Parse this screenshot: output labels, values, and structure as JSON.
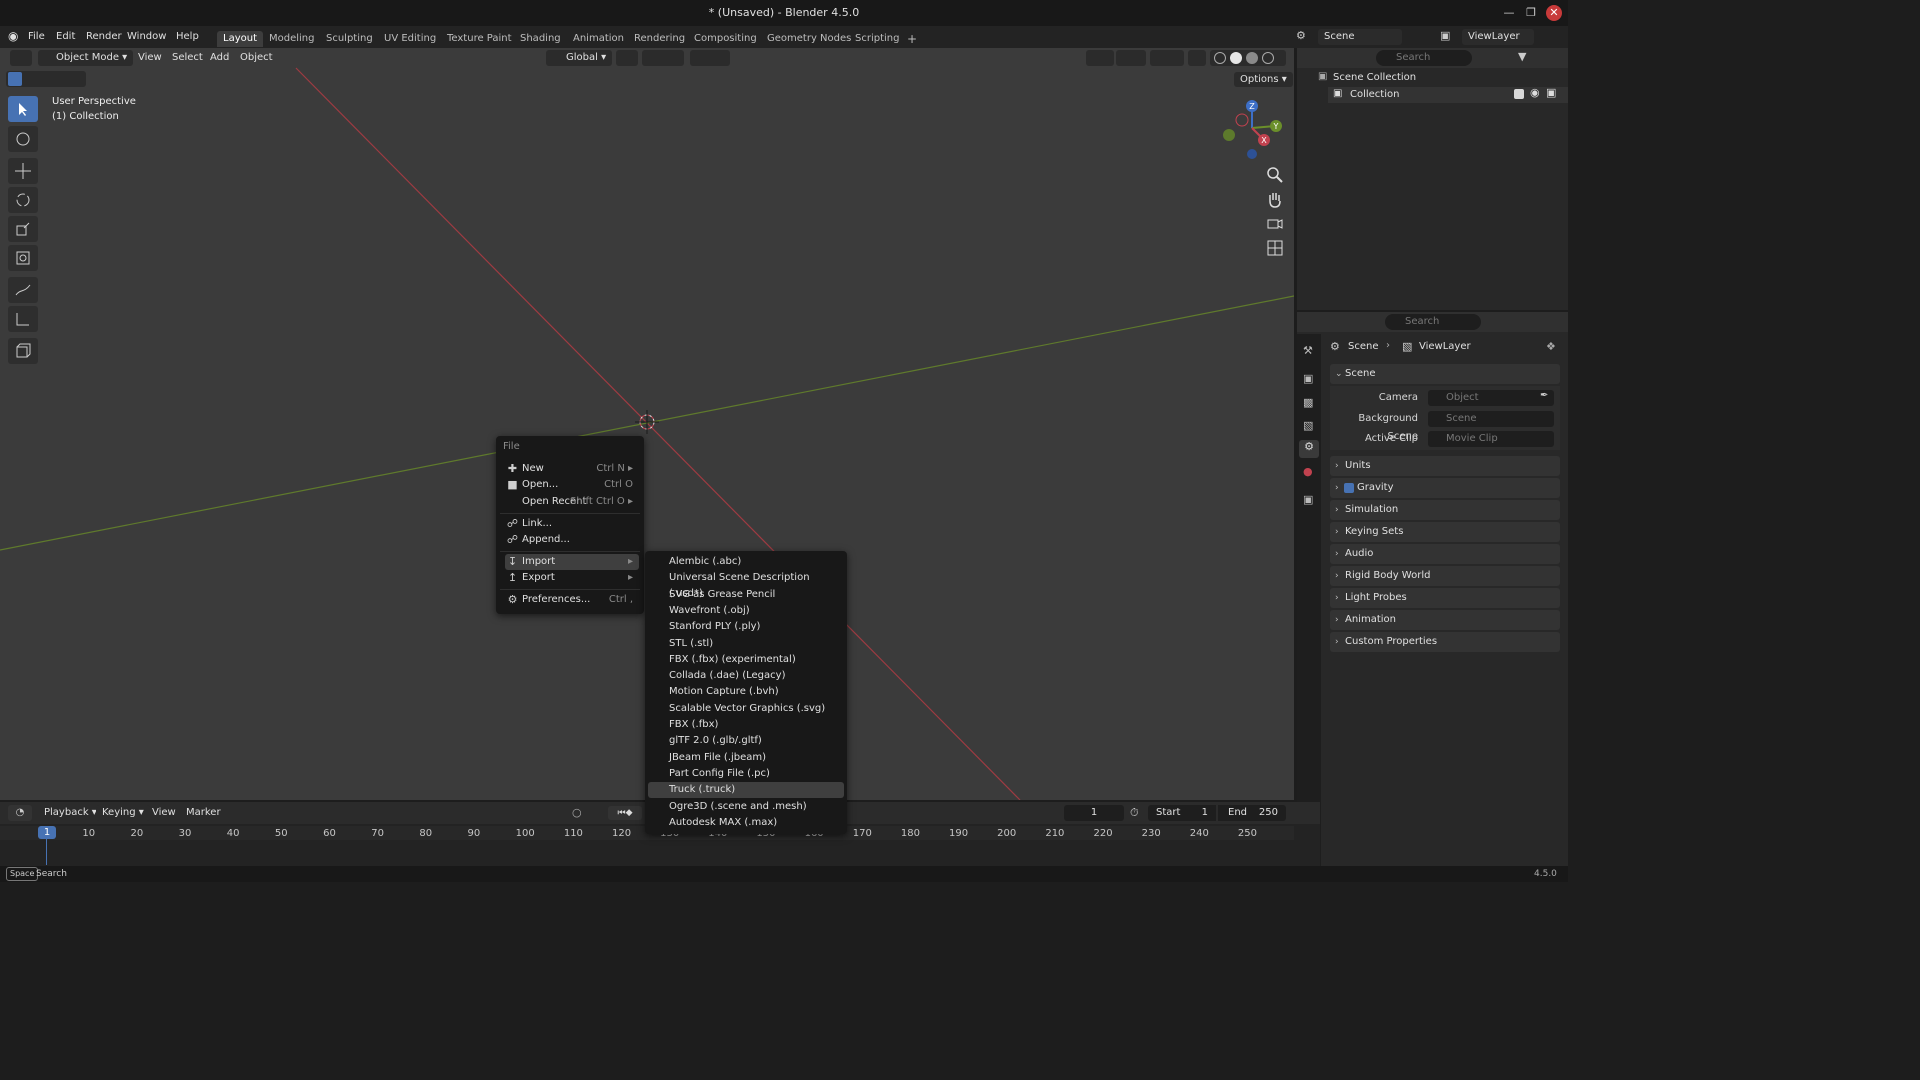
{
  "window": {
    "title": "* (Unsaved) - Blender 4.5.0"
  },
  "menubar": [
    "File",
    "Edit",
    "Render",
    "Window",
    "Help"
  ],
  "workspaces": [
    "Layout",
    "Modeling",
    "Sculpting",
    "UV Editing",
    "Texture Paint",
    "Shading",
    "Animation",
    "Rendering",
    "Compositing",
    "Geometry Nodes",
    "Scripting"
  ],
  "workspace_add": "+",
  "viewport_header": {
    "mode": "Object Mode",
    "menus": [
      "View",
      "Select",
      "Add",
      "Object"
    ],
    "orientation": "Global",
    "options": "Options"
  },
  "viewport_overlay": {
    "perspective": "User Perspective",
    "collection": "(1) Collection"
  },
  "gizmo": {
    "z": "Z",
    "y": "Y",
    "x": "X"
  },
  "outliner": {
    "scene": "Scene",
    "view_layer": "ViewLayer",
    "search_placeholder": "Search",
    "scene_collection": "Scene Collection",
    "collection": "Collection"
  },
  "properties": {
    "search_placeholder": "Search",
    "breadcrumb_scene": "Scene",
    "breadcrumb_viewlayer": "ViewLayer",
    "scene_panel": "Scene",
    "camera_label": "Camera",
    "camera_value": "Object",
    "bg_label": "Background Scene",
    "bg_value": "Scene",
    "clip_label": "Active Clip",
    "clip_value": "Movie Clip",
    "panels": [
      "Units",
      "Gravity",
      "Simulation",
      "Keying Sets",
      "Audio",
      "Rigid Body World",
      "Light Probes",
      "Animation",
      "Custom Properties"
    ]
  },
  "file_menu": {
    "title": "File",
    "new": "New",
    "new_sc": "Ctrl N",
    "open": "Open...",
    "open_sc": "Ctrl O",
    "recent": "Open Recent",
    "recent_sc": "Shift Ctrl O",
    "link": "Link...",
    "append": "Append...",
    "import": "Import",
    "export": "Export",
    "prefs": "Preferences...",
    "prefs_sc": "Ctrl ,"
  },
  "import_menu": [
    "Alembic (.abc)",
    "Universal Scene Description (.usd*)",
    "SVG as Grease Pencil",
    "Wavefront (.obj)",
    "Stanford PLY (.ply)",
    "STL (.stl)",
    "FBX (.fbx) (experimental)",
    "Collada (.dae) (Legacy)",
    "Motion Capture (.bvh)",
    "Scalable Vector Graphics (.svg)",
    "FBX (.fbx)",
    "glTF 2.0 (.glb/.gltf)",
    "JBeam File (.jbeam)",
    "Part Config File (.pc)",
    "Truck (.truck)",
    "Ogre3D (.scene and .mesh)",
    "Autodesk MAX (.max)"
  ],
  "timeline": {
    "menus": [
      "Playback",
      "Keying",
      "View",
      "Marker"
    ],
    "current_frame": "1",
    "start_label": "Start",
    "start_value": "1",
    "end_label": "End",
    "end_value": "250",
    "ticks": [
      "1",
      "10",
      "20",
      "30",
      "40",
      "50",
      "60",
      "70",
      "80",
      "90",
      "100",
      "110",
      "120",
      "130",
      "140",
      "150",
      "160",
      "170",
      "180",
      "190",
      "200",
      "210",
      "220",
      "230",
      "240",
      "250"
    ]
  },
  "statusbar": {
    "key": "Space",
    "action": "Search",
    "version": "4.5.0"
  },
  "colors": {
    "accent": "#4772b3",
    "x_axis": "#c1424f",
    "y_axis": "#7d9c3a"
  }
}
